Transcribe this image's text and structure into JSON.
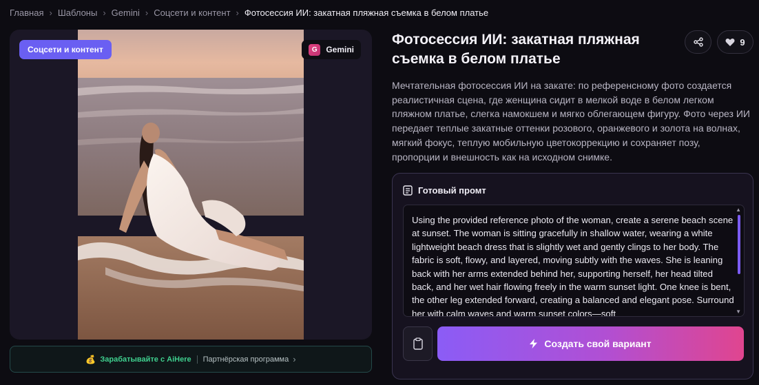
{
  "breadcrumb": {
    "items": [
      "Главная",
      "Шаблоны",
      "Gemini",
      "Соцсети и контент"
    ],
    "current": "Фотосессия ИИ: закатная пляжная съемка в белом платье",
    "separator": "›"
  },
  "image_card": {
    "category_badge": "Соцсети и контент",
    "model_badge": "Gemini",
    "model_badge_icon_letter": "G"
  },
  "partner_bar": {
    "earn_label": "Зарабатывайте с AiHere",
    "program_label": "Партнёрская программа"
  },
  "header": {
    "title": "Фотосессия ИИ: закатная пляжная съемка в белом платье",
    "like_count": "9"
  },
  "description": "Мечтательная фотосессия ИИ на закате: по референсному фото создается реалистичная сцена, где женщина сидит в мелкой воде в белом легком пляжном платье, слегка намокшем и мягко облегающем фигуру. Фото через ИИ передает теплые закатные оттенки розового, оранжевого и золота на волнах, мягкий фокус, теплую мобильную цветокоррекцию и сохраняет позу, пропорции и внешность как на исходном снимке.",
  "prompt": {
    "header": "Готовый промт",
    "text": "Using the provided reference photo of the woman, create a serene beach scene at sunset. The woman is sitting gracefully in shallow water, wearing a white lightweight beach dress that is slightly wet and gently clings to her body. The fabric is soft, flowy, and layered, moving subtly with the waves. She is leaning back with her arms extended behind her, supporting herself, her head tilted back, and her wet hair flowing freely in the warm sunset light. One knee is bent, the other leg extended forward, creating a balanced and elegant pose. Surround her with calm waves and warm sunset colors—soft",
    "create_label": "Создать свой вариант"
  },
  "colors": {
    "accent_purple": "#6a5ff2",
    "gradient_start": "#8b5cf6",
    "gradient_end": "#e0458f",
    "earn_green": "#3fcf8e"
  },
  "icons": [
    "share-icon",
    "heart-icon",
    "document-icon",
    "clipboard-icon",
    "lightning-icon",
    "coin-icon",
    "chevron-right-icon"
  ]
}
